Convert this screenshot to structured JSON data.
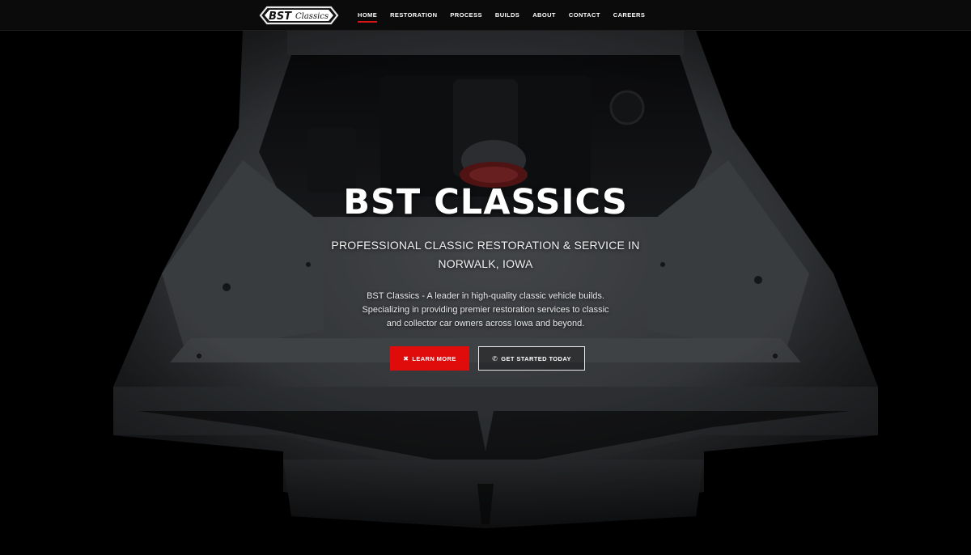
{
  "nav": {
    "logo_text": "BST Classics",
    "items": [
      {
        "label": "HOME",
        "active": true
      },
      {
        "label": "RESTORATION",
        "active": false
      },
      {
        "label": "PROCESS",
        "active": false
      },
      {
        "label": "BUILDS",
        "active": false
      },
      {
        "label": "ABOUT",
        "active": false
      },
      {
        "label": "CONTACT",
        "active": false
      },
      {
        "label": "CAREERS",
        "active": false
      }
    ],
    "accent_color": "#d41414"
  },
  "hero": {
    "title": "BST CLASSICS",
    "subtitle_line1": "PROFESSIONAL CLASSIC RESTORATION & SERVICE IN",
    "subtitle_line2": "NORWALK, IOWA",
    "desc_line1": "BST Classics - A leader in high-quality classic vehicle builds.",
    "desc_line2": "Specializing in providing premier restoration services to classic",
    "desc_line3": "and collector car owners across Iowa and beyond.",
    "primary_button": {
      "label": "LEARN MORE",
      "icon": "wrench-cross-icon",
      "color": "#e00b0b"
    },
    "secondary_button": {
      "label": "GET STARTED TODAY",
      "icon": "phone-icon"
    }
  }
}
